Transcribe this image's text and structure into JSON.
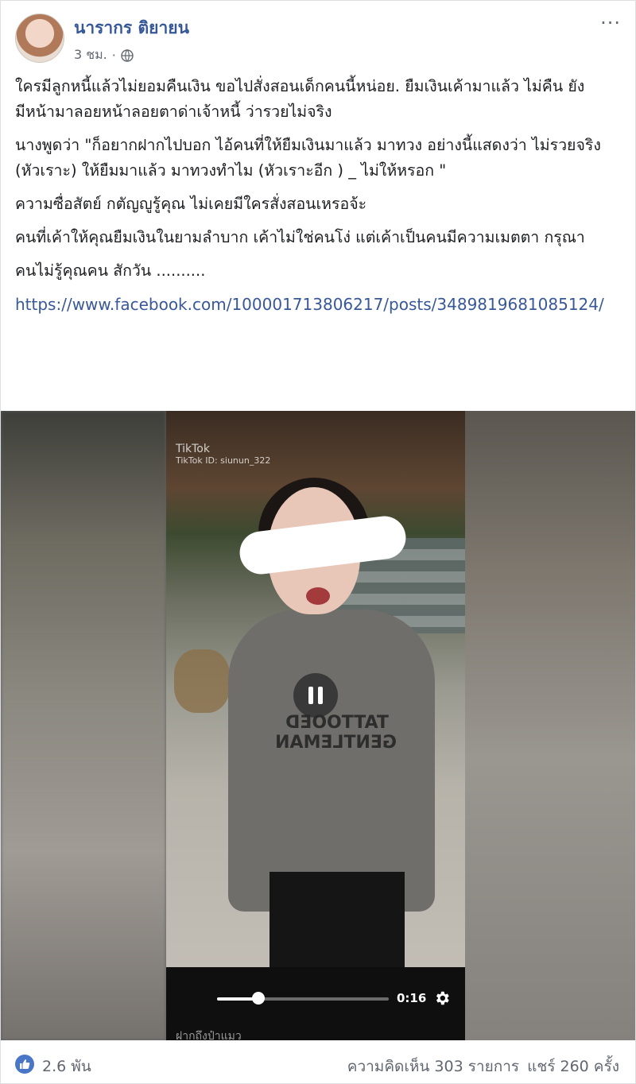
{
  "post": {
    "author": "นารากร ติยายน",
    "time": "3 ชม.",
    "separator": "·",
    "more": "···",
    "paragraphs": [
      "ใครมีลูกหนี้แล้วไม่ยอมคืนเงิน ขอไปสั่งสอนเด็กคนนี้หน่อย. ยืมเงินเค้ามาแล้ว ไม่คืน ยังมีหน้ามาลอยหน้าลอยตาด่าเจ้าหนี้ ว่ารวยไม่จริง",
      "นางพูดว่า \"ก็อยากฝากไปบอก ไอ้คนที่ให้ยืมเงินมาแล้ว มาทวง อย่างนี้แสดงว่า ไม่รวยจริง (หัวเราะ) ให้ยืมมาแล้ว มาทวงทำไม (หัวเราะอีก ) _ ไม่ให้หรอก \"",
      "ความซื่อสัตย์ กตัญญูรู้คุณ ไม่เคยมีใครสั่งสอนเหรอจ้ะ",
      "คนที่เค้าให้คุณยืมเงินในยามลำบาก เค้าไม่ใช่คนโง่ แต่เค้าเป็นคนมีความเมตตา กรุณา",
      "คนไม่รู้คุณคน สักวัน .........."
    ],
    "link": "https://www.facebook.com/100001713806217/posts/3489819681085124/"
  },
  "video": {
    "watermark": "TikTok",
    "watermark_id": "TikTok ID: siunun_322",
    "shirt_text": "TATTOOED GENTLEMAN",
    "time": "0:16",
    "progress": 0.24,
    "caption": "ฝากถึงป๋าแมว",
    "icons": {
      "pause": "pause-icon",
      "settings": "gear-icon"
    }
  },
  "footer": {
    "likes": "2.6 พัน",
    "comments": "ความคิดเห็น 303 รายการ",
    "shares": "แชร์ 260 ครั้ง"
  },
  "colors": {
    "link": "#385898",
    "author": "#365899",
    "like": "#4a76c8"
  }
}
